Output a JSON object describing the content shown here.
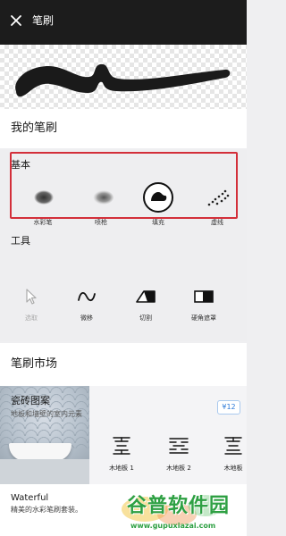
{
  "topbar": {
    "title": "笔刷"
  },
  "my_brushes": {
    "heading": "我的笔刷"
  },
  "basic": {
    "heading": "基本",
    "items": [
      {
        "label": "水彩笔",
        "icon": "watercolor-brush-icon"
      },
      {
        "label": "喷枪",
        "icon": "airbrush-icon"
      },
      {
        "label": "填充",
        "icon": "fill-icon",
        "selected": true
      },
      {
        "label": "虚线",
        "icon": "dotted-line-icon"
      }
    ]
  },
  "tools": {
    "heading": "工具",
    "items": [
      {
        "label": "选取",
        "icon": "cursor-icon",
        "disabled": true
      },
      {
        "label": "微移",
        "icon": "nudge-wave-icon"
      },
      {
        "label": "切割",
        "icon": "cut-icon"
      },
      {
        "label": "硬角遮罩",
        "icon": "hard-mask-icon"
      }
    ]
  },
  "market": {
    "heading": "笔刷市场",
    "card": {
      "title": "瓷砖图案",
      "subtitle": "地板和墙壁的室内元素",
      "price": "¥12",
      "items": [
        {
          "label": "木地板 1"
        },
        {
          "label": "木地板 2"
        },
        {
          "label": "木地板"
        }
      ]
    },
    "bottom_card": {
      "title": "Waterful",
      "subtitle": "精美的水彩笔刷套装。"
    }
  },
  "watermark": {
    "main": "谷普软件园",
    "url": "www.gupuxiazai.com"
  },
  "colors": {
    "highlight_frame": "#d32f3a",
    "price_blue": "#2e7bd8",
    "watermark_green": "#2ea043",
    "topbar": "#1c1c1c"
  }
}
